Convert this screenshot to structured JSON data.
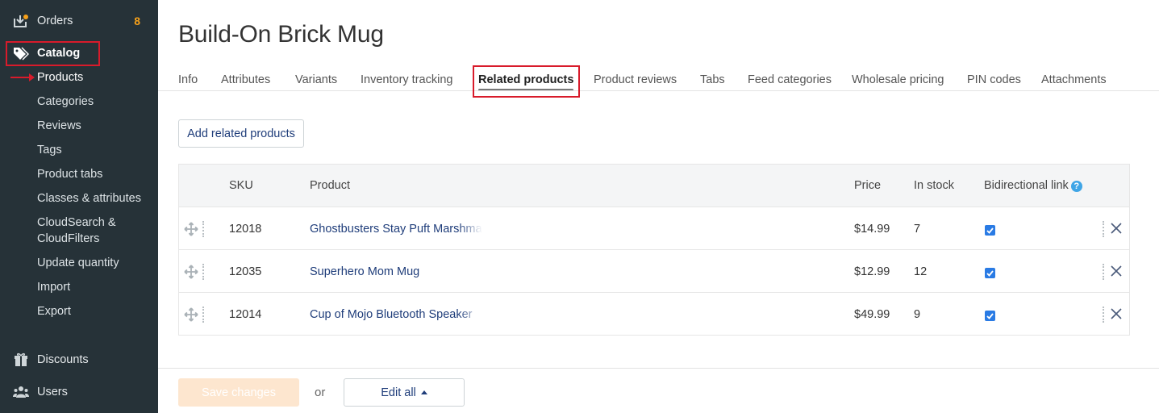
{
  "sidebar": {
    "orders": {
      "label": "Orders",
      "badge": "8"
    },
    "catalog": {
      "label": "Catalog"
    },
    "catalog_items": [
      "Products",
      "Categories",
      "Reviews",
      "Tags",
      "Product tabs",
      "Classes & attributes",
      "CloudSearch &",
      "CloudFilters",
      "Update quantity",
      "Import",
      "Export"
    ],
    "discounts": {
      "label": "Discounts"
    },
    "users": {
      "label": "Users"
    }
  },
  "page": {
    "title": "Build-On Brick Mug",
    "tabs": [
      "Info",
      "Attributes",
      "Variants",
      "Inventory tracking",
      "Related products",
      "Product reviews",
      "Tabs",
      "Feed categories",
      "Wholesale pricing",
      "PIN codes",
      "Attachments"
    ],
    "active_tab": "Related products"
  },
  "add_button": "Add related products",
  "table": {
    "headers": {
      "sku": "SKU",
      "product": "Product",
      "price": "Price",
      "stock": "In stock",
      "bidirectional": "Bidirectional link",
      "help": "?"
    },
    "rows": [
      {
        "sku": "12018",
        "product": "Ghostbusters Stay Puft Marshmallow",
        "price": "$14.99",
        "stock": "7",
        "bidirectional": true
      },
      {
        "sku": "12035",
        "product": "Superhero Mom Mug",
        "price": "$12.99",
        "stock": "12",
        "bidirectional": true
      },
      {
        "sku": "12014",
        "product": "Cup of Mojo Bluetooth Speaker",
        "price": "$49.99",
        "stock": "9",
        "bidirectional": true
      }
    ]
  },
  "footer": {
    "save": "Save changes",
    "or": "or",
    "edit_all": "Edit all"
  },
  "colors": {
    "sidebar_bg": "#263238",
    "badge": "#f7a11a",
    "highlight": "#d81b2b",
    "link": "#1f3d7a",
    "checkbox": "#2a7be4",
    "save_disabled": "#fde6cf"
  }
}
